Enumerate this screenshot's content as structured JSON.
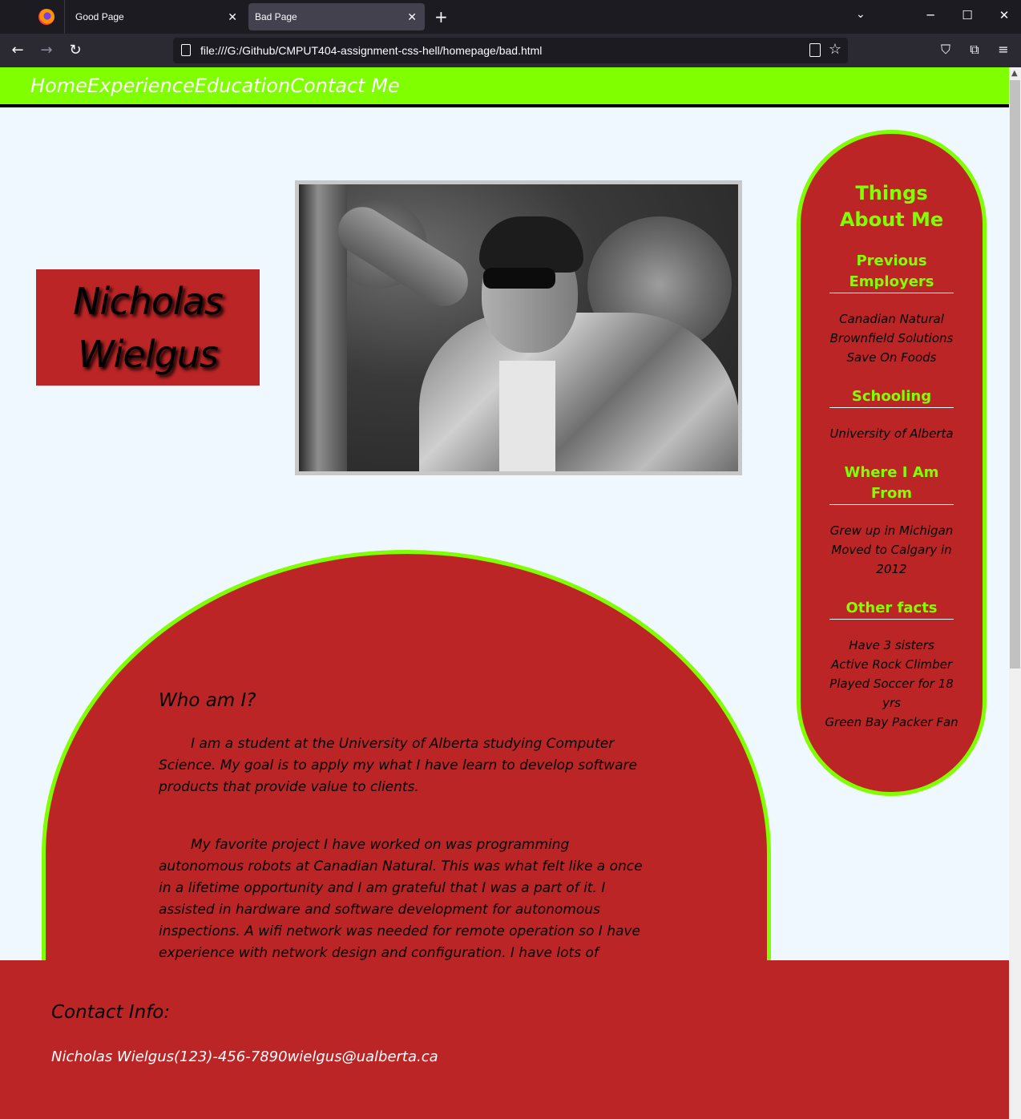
{
  "browser": {
    "tabs": [
      {
        "title": "Good Page",
        "active": false
      },
      {
        "title": "Bad Page",
        "active": true
      }
    ],
    "url": "file:///G:/Github/CMPUT404-assignment-css-hell/homepage/bad.html"
  },
  "nav": {
    "links": [
      "Home",
      "Experience",
      "Education",
      "Contact Me"
    ]
  },
  "hero": {
    "name": "Nicholas Wielgus"
  },
  "about": {
    "heading": "Who am I?",
    "paragraphs": [
      "I am a student at the University of Alberta studying Computer Science. My goal is to apply my what I have learn to develop software products that provide value to clients.",
      "My favorite project I have worked on was programming autonomous robots at Canadian Natural. This was what felt like a once in a lifetime opportunity and I am grateful that I was a part of it. I assisted in hardware and software development for autonomous inspections. A wifi network was needed for remote operation so I have experience with network design and configuration. I have lots of experience developing"
    ]
  },
  "sidebar": {
    "title": "Things About Me",
    "sections": [
      {
        "heading": "Previous Employers",
        "items": [
          "Canadian Natural",
          "Brownfield Solutions",
          "Save On Foods"
        ]
      },
      {
        "heading": "Schooling",
        "items": [
          "University of Alberta"
        ]
      },
      {
        "heading": "Where I Am From",
        "items": [
          "Grew up in Michigan",
          "Moved to Calgary in 2012"
        ]
      },
      {
        "heading": "Other facts",
        "items": [
          "Have 3 sisters",
          "Active Rock Climber",
          "Played Soccer for 18 yrs",
          "Green Bay Packer Fan"
        ]
      }
    ]
  },
  "footer": {
    "heading": "Contact Info:",
    "name": "Nicholas Wielgus",
    "phone": "(123)-456-7890",
    "email": "wielgus@ualberta.ca"
  },
  "colors": {
    "accent_green": "#7fff00",
    "brand_red": "#bc2526",
    "page_bg": "#f0f8ff"
  }
}
